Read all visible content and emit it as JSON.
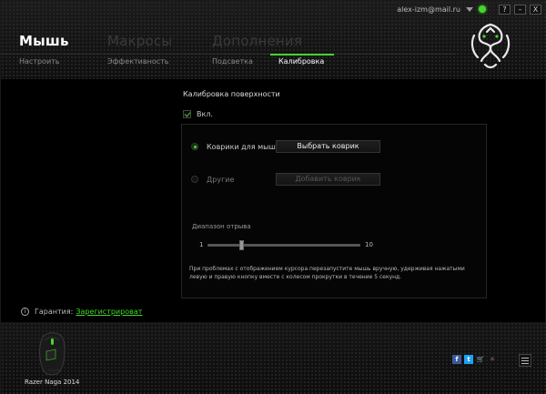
{
  "topbar": {
    "email": "alex-izm@mail.ru",
    "help_label": "?",
    "minimize_label": "–",
    "close_label": "X"
  },
  "main_tabs": [
    "Мышь",
    "Макросы",
    "Дополнения"
  ],
  "sub_tabs": [
    "Настроить",
    "Эффективность",
    "Подсветка",
    "Калибровка"
  ],
  "active_sub_tab": "Калибровка",
  "calibration": {
    "title": "Калибровка поверхности",
    "enable_label": "Вкл.",
    "enabled": true,
    "mats_label": "Коврики для мыш",
    "select_mat_button": "Выбрать коврик",
    "other_label": "Другие",
    "add_mat_button": "Добавить коврик",
    "lift_label": "Диапазон отрыва",
    "slider_min": "1",
    "slider_max": "10",
    "slider_value": 3,
    "hint": "При проблемах с отображением курсора перезапустите мышь вручную, удерживая нажатыми левую и правую кнопку вместе с колесом прокрутки в течение 5 секунд."
  },
  "warranty": {
    "info_icon": "i",
    "label": "Гарантия:",
    "link": "Зарегистрироват"
  },
  "footer": {
    "device_name": "Razer Naga 2014",
    "fb": "f",
    "tw": "t",
    "cart": "🛒",
    "tools": "✧"
  },
  "colors": {
    "accent": "#44d62c",
    "background": "#000000"
  }
}
